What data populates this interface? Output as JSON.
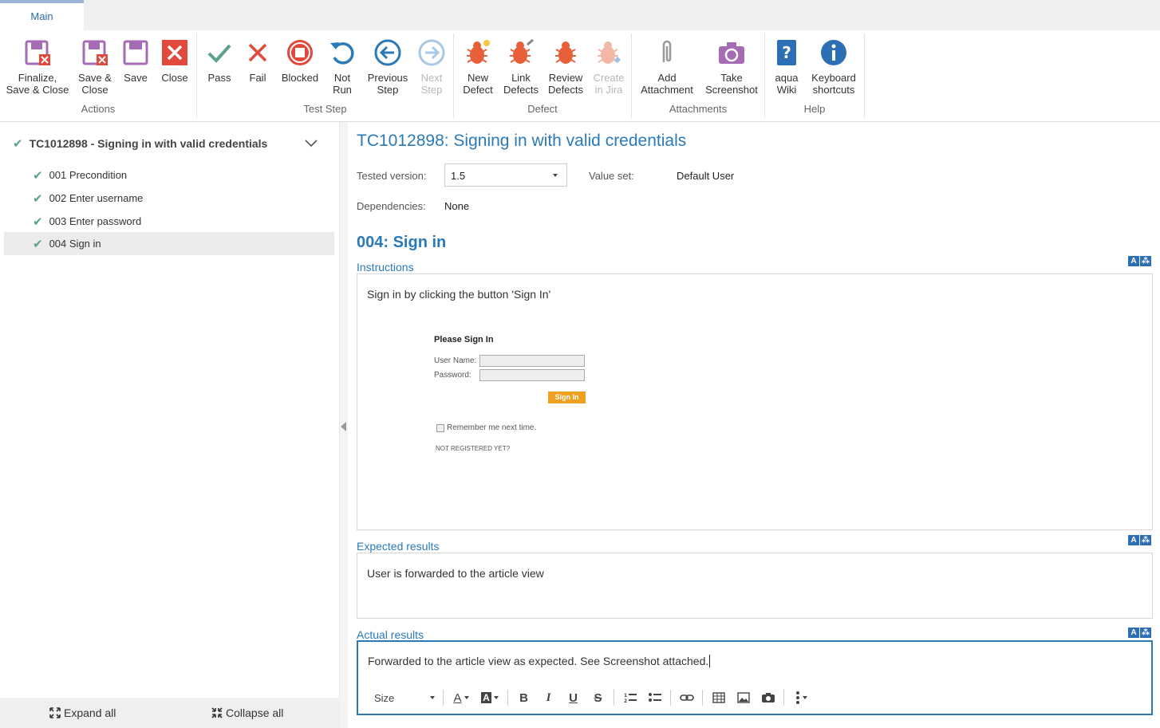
{
  "ribbon": {
    "tab_main": "Main",
    "groups": {
      "actions": "Actions",
      "test_step": "Test Step",
      "defect": "Defect",
      "attachments": "Attachments",
      "help": "Help"
    },
    "buttons": {
      "finalize_1": "Finalize,",
      "finalize_2": "Save & Close",
      "save_close_1": "Save &",
      "save_close_2": "Close",
      "save": "Save",
      "close": "Close",
      "pass": "Pass",
      "fail": "Fail",
      "blocked": "Blocked",
      "not_run_1": "Not",
      "not_run_2": "Run",
      "prev_1": "Previous",
      "prev_2": "Step",
      "next_1": "Next",
      "next_2": "Step",
      "new_defect_1": "New",
      "new_defect_2": "Defect",
      "link_defects_1": "Link",
      "link_defects_2": "Defects",
      "review_defects_1": "Review",
      "review_defects_2": "Defects",
      "create_jira_1": "Create",
      "create_jira_2": "in Jira",
      "add_att_1": "Add",
      "add_att_2": "Attachment",
      "take_ss_1": "Take",
      "take_ss_2": "Screenshot",
      "aqua_wiki_1": "aqua",
      "aqua_wiki_2": "Wiki",
      "keyboard_1": "Keyboard",
      "keyboard_2": "shortcuts"
    }
  },
  "tree": {
    "root": "TC1012898 - Signing in with valid credentials",
    "steps": [
      "001 Precondition",
      "002 Enter username",
      "003 Enter password",
      "004 Sign in"
    ],
    "expand_all": "Expand all",
    "collapse_all": "Collapse all"
  },
  "detail": {
    "title": "TC1012898: Signing in with valid credentials",
    "tested_version_label": "Tested version:",
    "tested_version_value": "1.5",
    "value_set_label": "Value set:",
    "value_set_value": "Default User",
    "dependencies_label": "Dependencies:",
    "dependencies_value": "None",
    "step_title": "004: Sign in",
    "instructions_label": "Instructions",
    "instructions_text": "Sign in by clicking the button 'Sign In'",
    "expected_label": "Expected results",
    "expected_text": "User is forwarded to the article view",
    "actual_label": "Actual results",
    "actual_text": "Forwarded to the article view as expected. See Screenshot attached.",
    "toolbar_size": "Size",
    "az_a": "A",
    "az_b": "⁂"
  },
  "embedded_signin": {
    "title": "Please Sign In",
    "user_name": "User Name:",
    "password": "Password:",
    "button": "Sign In",
    "remember": "Remember me next time.",
    "not_registered": "NOT REGISTERED YET?"
  },
  "colors": {
    "accent": "#2a7ab9",
    "pass": "#5aa28a",
    "fail": "#e0493c",
    "defect": "#e8603a",
    "purple": "#a66bb5"
  }
}
